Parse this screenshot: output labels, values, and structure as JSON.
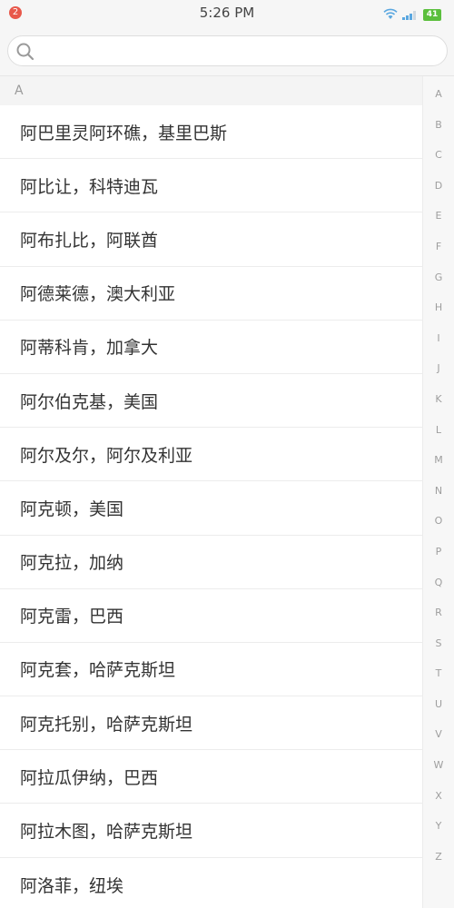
{
  "status_bar": {
    "notification_count": "2",
    "time": "5:26 PM",
    "battery": "41",
    "colors": {
      "badge": "#e8584b",
      "battery": "#5bbf3d"
    },
    "icons": [
      "wifi-icon",
      "signal-icon",
      "battery-icon"
    ]
  },
  "search": {
    "placeholder": "",
    "value": "",
    "icon": "search-icon"
  },
  "list": {
    "section_header": "A",
    "items": [
      "阿巴里灵阿环礁，基里巴斯",
      "阿比让，科特迪瓦",
      "阿布扎比，阿联酋",
      "阿德莱德，澳大利亚",
      "阿蒂科肯，加拿大",
      "阿尔伯克基，美国",
      "阿尔及尔，阿尔及利亚",
      "阿克顿，美国",
      "阿克拉，加纳",
      "阿克雷，巴西",
      "阿克套，哈萨克斯坦",
      "阿克托别，哈萨克斯坦",
      "阿拉瓜伊纳，巴西",
      "阿拉木图，哈萨克斯坦",
      "阿洛菲，纽埃"
    ]
  },
  "index_bar": {
    "letters": [
      "A",
      "B",
      "C",
      "D",
      "E",
      "F",
      "G",
      "H",
      "I",
      "J",
      "K",
      "L",
      "M",
      "N",
      "O",
      "P",
      "Q",
      "R",
      "S",
      "T",
      "U",
      "V",
      "W",
      "X",
      "Y",
      "Z"
    ]
  }
}
